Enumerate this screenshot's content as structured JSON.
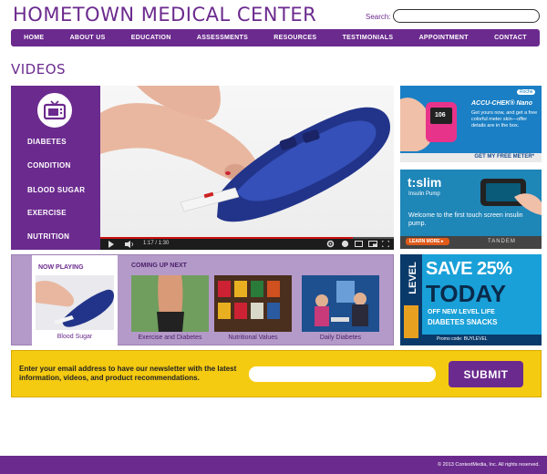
{
  "header": {
    "site_title": "HOMETOWN MEDICAL CENTER",
    "search_label": "Search:",
    "search_value": ""
  },
  "nav": {
    "items": [
      "HOME",
      "ABOUT US",
      "EDUCATION",
      "ASSESSMENTS",
      "RESOURCES",
      "TESTIMONIALS",
      "APPOINTMENT",
      "CONTACT"
    ]
  },
  "page_heading": "VIDEOS",
  "topics": {
    "icon": "tv-icon",
    "items": [
      "DIABETES",
      "CONDITION",
      "BLOOD SUGAR",
      "EXERCISE",
      "NUTRITION"
    ]
  },
  "player": {
    "time": "1:17 / 1:30",
    "progress": 0.86
  },
  "now_playing": {
    "title": "NOW PLAYING",
    "caption": "Blood Sugar"
  },
  "coming_up": {
    "title": "COMING UP NEXT",
    "items": [
      {
        "caption": "Exercise and Diabetes"
      },
      {
        "caption": "Nutritional Values"
      },
      {
        "caption": "Daily Diabetes"
      }
    ]
  },
  "ads": {
    "accuchek": {
      "logo": "Roche",
      "brand": "ACCU-CHEK® Nano",
      "body": "Get yours now, and get a free colorful meter skin—offer details are in the box.",
      "meter_reading": "106",
      "cta": "GET MY FREE METER*"
    },
    "tslim": {
      "brand": "t:slim",
      "sub": "Insulin Pump",
      "body": "Welcome to the first touch screen insulin pump.",
      "cta": "LEARN MORE ▸",
      "company": "TANDEM"
    },
    "level": {
      "brand": "LEVEL",
      "headline1": "SAVE 25%",
      "headline2": "TODAY",
      "sub1": "OFF NEW LEVEL LIFE",
      "sub2": "DIABETES SNACKS",
      "promo": "Promo code: BUYLEVEL"
    }
  },
  "newsletter": {
    "text": "Enter your email address to have our newsletter with the latest information, videos, and product recommendations.",
    "input_value": "",
    "submit_label": "SUBMIT"
  },
  "footer": {
    "copyright": "© 2013 ContextMedia, Inc. All rights reserved."
  },
  "colors": {
    "brand_purple": "#6b2a8e",
    "newsletter_yellow": "#f5cb12",
    "panel_lavender": "#b49ac8"
  }
}
